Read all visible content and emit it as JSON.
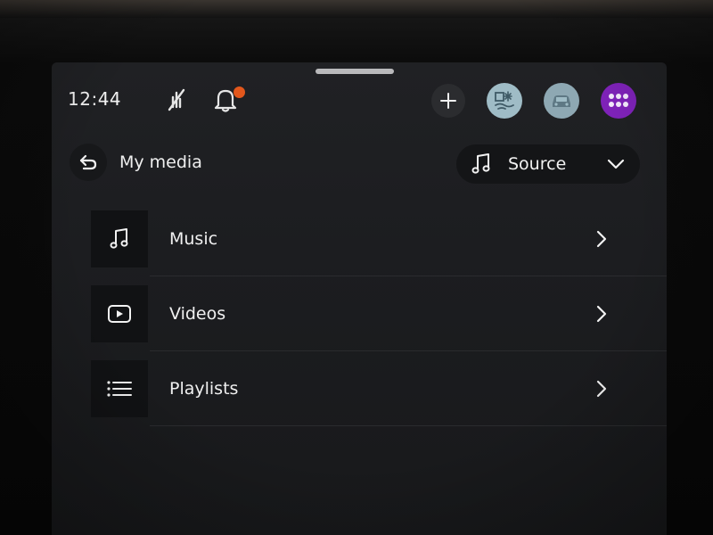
{
  "status_bar": {
    "time": "12:44",
    "icons": {
      "wifi": "wifi-off-icon",
      "notifications": "bell-icon",
      "notification_badge_color": "#e2571c",
      "add": "plus-icon",
      "climate": "climate-icon",
      "vehicle": "car-icon",
      "apps": "apps-grid-icon"
    }
  },
  "header": {
    "back_icon": "back-arrow-icon",
    "title": "My media",
    "source": {
      "icon": "music-note-icon",
      "label": "Source",
      "chevron": "chevron-down-icon"
    }
  },
  "media_menu": {
    "items": [
      {
        "label": "Music",
        "icon": "music-note-icon"
      },
      {
        "label": "Videos",
        "icon": "video-play-icon"
      },
      {
        "label": "Playlists",
        "icon": "list-icon"
      }
    ]
  },
  "colors": {
    "screen_bg": "#1e1f22",
    "tile_bg": "#111214",
    "apps_accent": "#7e22b8",
    "text": "#f0f0f0"
  }
}
